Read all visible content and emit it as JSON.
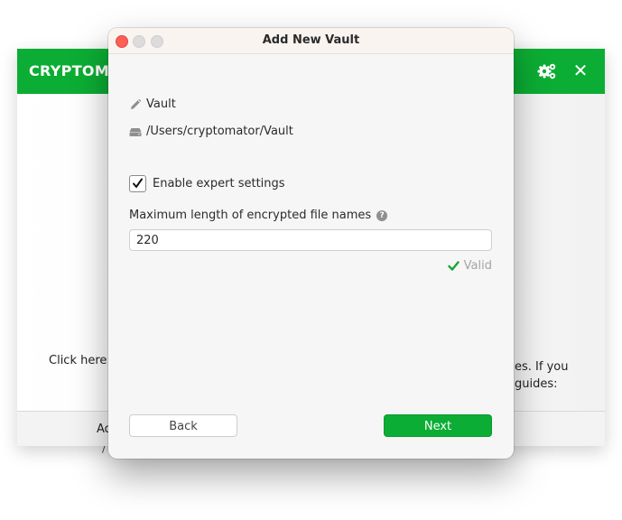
{
  "background_window": {
    "title": "CRYPTOMATOR",
    "icons": [
      "gears-icon",
      "close-icon"
    ],
    "close_glyph": "✕",
    "body_text_left": "Click here to",
    "body_text_right_line1": "es. If you",
    "body_text_right_line2": "guides:",
    "footer_text": "Ad",
    "brand_color": "#0cad34"
  },
  "dialog": {
    "title": "Add New Vault",
    "vault_name": "Vault",
    "vault_path": "/Users/cryptomator/Vault",
    "expert_settings": {
      "label": "Enable expert settings",
      "checked": true
    },
    "max_filename_length": {
      "label": "Maximum length of encrypted file names",
      "help_glyph": "?",
      "value": "220",
      "validation": "Valid"
    },
    "buttons": {
      "back": "Back",
      "next": "Next"
    },
    "accent_color": "#0cad34",
    "valid_color": "#1aa637"
  }
}
